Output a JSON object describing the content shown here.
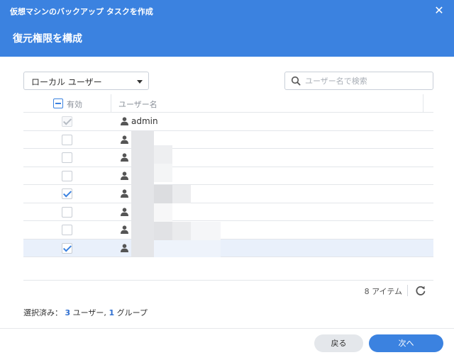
{
  "window": {
    "title": "仮想マシンのバックアップ タスクを作成",
    "step_title": "復元権限を構成",
    "close_icon": "close-icon"
  },
  "toolbar": {
    "type_select_value": "ローカル ユーザー",
    "search_placeholder": "ユーザー名で検索"
  },
  "grid": {
    "columns": [
      "有効",
      "ユーザー名"
    ],
    "rows": [
      {
        "checked": true,
        "disabled": true,
        "name": "admin",
        "selected": false
      },
      {
        "checked": false,
        "disabled": false,
        "name": "",
        "selected": false
      },
      {
        "checked": false,
        "disabled": false,
        "name": "",
        "selected": false
      },
      {
        "checked": false,
        "disabled": false,
        "name": "",
        "selected": false
      },
      {
        "checked": true,
        "disabled": false,
        "name": "",
        "selected": false
      },
      {
        "checked": false,
        "disabled": false,
        "name": "",
        "selected": false
      },
      {
        "checked": false,
        "disabled": false,
        "name": "",
        "selected": false
      },
      {
        "checked": true,
        "disabled": false,
        "name": "",
        "selected": true
      }
    ],
    "item_count": "8 アイテム"
  },
  "summary": {
    "prefix": "選択済み：",
    "user_count": "3",
    "user_label": "ユーザー, ",
    "group_count": "1",
    "group_label": "グループ"
  },
  "buttons": {
    "back": "戻る",
    "next": "次へ"
  },
  "colors": {
    "accent": "#3b82e0",
    "selected_row": "#e9f0fb"
  }
}
